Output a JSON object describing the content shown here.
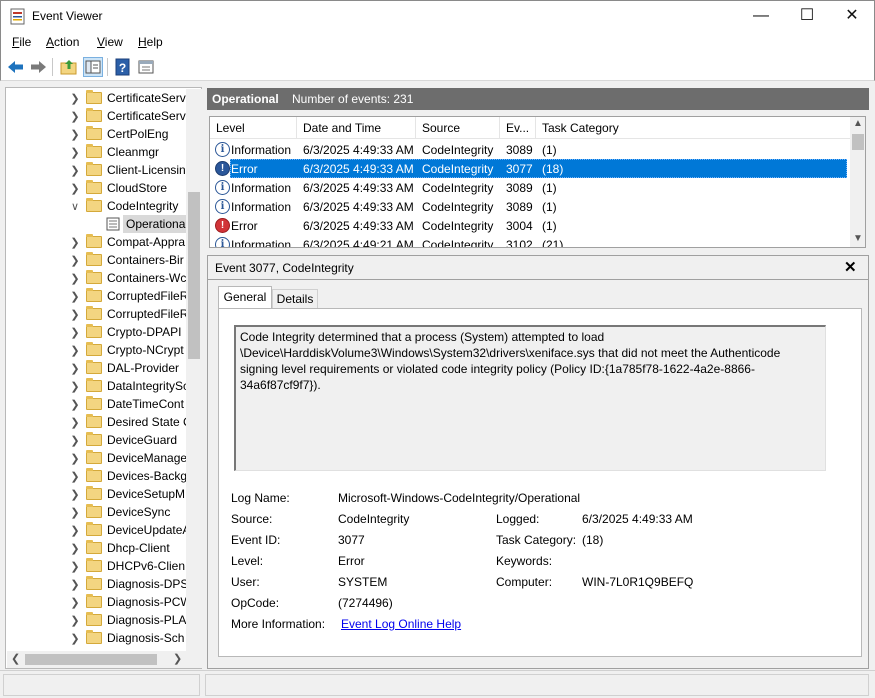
{
  "window": {
    "title": "Event Viewer",
    "minimize_glyph": "—",
    "maximize_glyph": "☐",
    "close_glyph": "✕"
  },
  "menu": [
    "File",
    "Action",
    "View",
    "Help"
  ],
  "menu_accel": [
    "F",
    "A",
    "V",
    "H"
  ],
  "menu_rest": [
    "ile",
    "ction",
    "iew",
    "elp"
  ],
  "toolbar": {
    "icons": [
      "back-arrow-icon",
      "forward-arrow-icon",
      "up-folder-icon",
      "show-hide-tree-icon",
      "help-icon",
      "properties-icon"
    ]
  },
  "tree": {
    "items": [
      {
        "label": "CertificateServ",
        "expanded": false
      },
      {
        "label": "CertificateServ",
        "expanded": false
      },
      {
        "label": "CertPolEng",
        "expanded": false
      },
      {
        "label": "Cleanmgr",
        "expanded": false
      },
      {
        "label": "Client-Licensin",
        "expanded": false
      },
      {
        "label": "CloudStore",
        "expanded": false
      },
      {
        "label": "CodeIntegrity",
        "expanded": true
      },
      {
        "label": "Operationa",
        "selected": true,
        "child": true
      },
      {
        "label": "Compat-Appra",
        "expanded": false
      },
      {
        "label": "Containers-Bir",
        "expanded": false
      },
      {
        "label": "Containers-Wc",
        "expanded": false
      },
      {
        "label": "CorruptedFileR",
        "expanded": false
      },
      {
        "label": "CorruptedFileR",
        "expanded": false
      },
      {
        "label": "Crypto-DPAPI",
        "expanded": false
      },
      {
        "label": "Crypto-NCrypt",
        "expanded": false
      },
      {
        "label": "DAL-Provider",
        "expanded": false
      },
      {
        "label": "DataIntegritySc",
        "expanded": false
      },
      {
        "label": "DateTimeCont",
        "expanded": false
      },
      {
        "label": "Desired State C",
        "expanded": false
      },
      {
        "label": "DeviceGuard",
        "expanded": false
      },
      {
        "label": "DeviceManage",
        "expanded": false
      },
      {
        "label": "Devices-Backg",
        "expanded": false
      },
      {
        "label": "DeviceSetupM",
        "expanded": false
      },
      {
        "label": "DeviceSync",
        "expanded": false
      },
      {
        "label": "DeviceUpdateA",
        "expanded": false
      },
      {
        "label": "Dhcp-Client",
        "expanded": false
      },
      {
        "label": "DHCPv6-Clien",
        "expanded": false
      },
      {
        "label": "Diagnosis-DPS",
        "expanded": false
      },
      {
        "label": "Diagnosis-PCW",
        "expanded": false
      },
      {
        "label": "Diagnosis-PLA",
        "expanded": false
      },
      {
        "label": "Diagnosis-Sch",
        "expanded": false
      }
    ]
  },
  "events_header": {
    "title": "Operational",
    "count_text": "Number of events: 231"
  },
  "events": {
    "columns": [
      "Level",
      "Date and Time",
      "Source",
      "Ev...",
      "Task Category"
    ],
    "rows": [
      {
        "level": "Information",
        "type": "info",
        "datetime": "6/3/2025 4:49:33 AM",
        "source": "CodeIntegrity",
        "event_id": "3089",
        "task": "(1)"
      },
      {
        "level": "Error",
        "type": "error",
        "datetime": "6/3/2025 4:49:33 AM",
        "source": "CodeIntegrity",
        "event_id": "3077",
        "task": "(18)",
        "selected": true
      },
      {
        "level": "Information",
        "type": "info",
        "datetime": "6/3/2025 4:49:33 AM",
        "source": "CodeIntegrity",
        "event_id": "3089",
        "task": "(1)"
      },
      {
        "level": "Information",
        "type": "info",
        "datetime": "6/3/2025 4:49:33 AM",
        "source": "CodeIntegrity",
        "event_id": "3089",
        "task": "(1)"
      },
      {
        "level": "Error",
        "type": "error",
        "datetime": "6/3/2025 4:49:33 AM",
        "source": "CodeIntegrity",
        "event_id": "3004",
        "task": "(1)"
      },
      {
        "level": "Information",
        "type": "info",
        "datetime": "6/3/2025 4:49:21 AM",
        "source": "CodeIntegrity",
        "event_id": "3102",
        "task": "(21)"
      }
    ]
  },
  "detail": {
    "title": "Event 3077, CodeIntegrity",
    "close_glyph": "✕",
    "tabs": [
      "General",
      "Details"
    ],
    "description": "Code Integrity determined that a process (System) attempted to load \\Device\\HarddiskVolume3\\Windows\\System32\\drivers\\xeniface.sys that did not meet the Authenticode signing level requirements or violated code integrity policy (Policy ID:{1a785f78-1622-4a2e-8866-34a6f87cf9f7}).",
    "fields": {
      "log_name_label": "Log Name:",
      "log_name": "Microsoft-Windows-CodeIntegrity/Operational",
      "source_label": "Source:",
      "source": "CodeIntegrity",
      "logged_label": "Logged:",
      "logged": "6/3/2025 4:49:33 AM",
      "event_id_label": "Event ID:",
      "event_id": "3077",
      "task_category_label": "Task Category:",
      "task_category": "(18)",
      "level_label": "Level:",
      "level": "Error",
      "keywords_label": "Keywords:",
      "keywords": "",
      "user_label": "User:",
      "user": "SYSTEM",
      "computer_label": "Computer:",
      "computer": "WIN-7L0R1Q9BEFQ",
      "opcode_label": "OpCode:",
      "opcode": "(7274496)",
      "more_info_label": "More Information:",
      "more_info_link": "Event Log Online Help"
    }
  }
}
